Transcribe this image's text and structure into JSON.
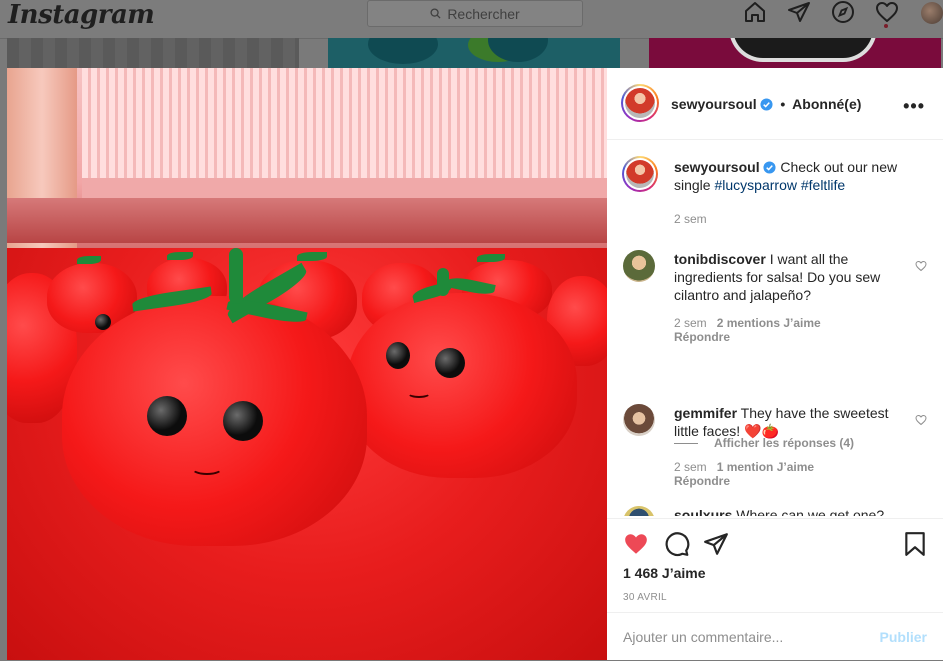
{
  "nav": {
    "logo": "Instagram",
    "search_placeholder": "Rechercher",
    "icons": [
      "home-icon",
      "direct-icon",
      "explore-icon",
      "activity-heart-icon",
      "profile-avatar"
    ]
  },
  "post": {
    "author": {
      "username": "sewyoursoul",
      "verified": true,
      "follow_status": "Abonné(e)"
    },
    "caption": {
      "username": "sewyoursoul",
      "text": "Check out our new single",
      "hashtags": [
        "#lucysparrow",
        "#feltlife"
      ],
      "time": "2 sem"
    },
    "comments": [
      {
        "username": "tonibdiscover",
        "text": "I want all the ingredients for salsa! Do you sew cilantro and jalapeño?",
        "time": "2 sem",
        "likes": "2 mentions J’aime",
        "reply": "Répondre",
        "view_replies": "Afficher les réponses (4)"
      },
      {
        "username": "gemmifer",
        "text": "They have the sweetest little faces! ❤️🍅",
        "time": "2 sem",
        "likes": "1 mention J’aime",
        "reply": "Répondre"
      },
      {
        "username": "soulxurs",
        "text": "Where can we get one?"
      }
    ],
    "likes_count": "1 468 J’aime",
    "date": "30 avril",
    "add_comment_placeholder": "Ajouter un commentaire...",
    "publish_label": "Publier"
  },
  "colors": {
    "like_red": "#ed4956",
    "link_blue": "#00376b",
    "verified_blue": "#3897f0",
    "publish_disabled": "#b2dffc",
    "overlay_gray": "#7a7a7a"
  }
}
